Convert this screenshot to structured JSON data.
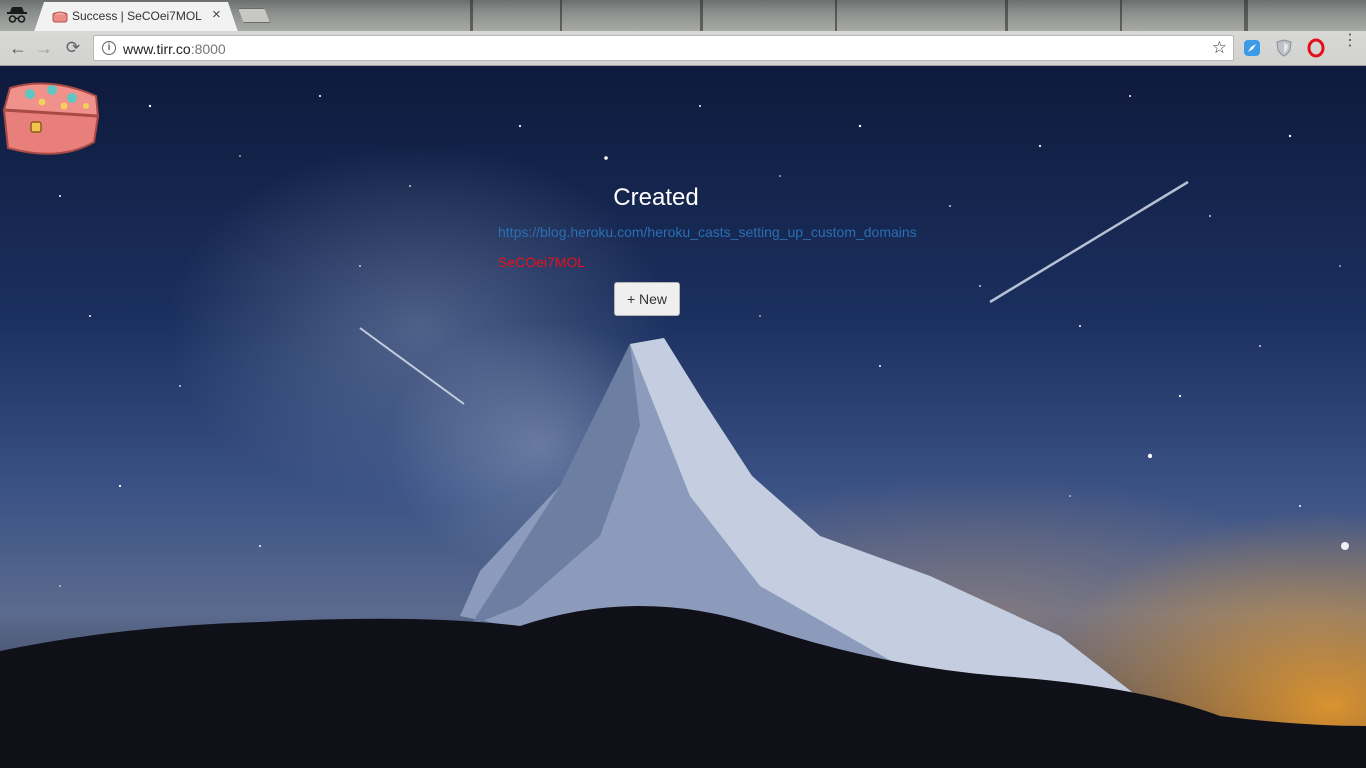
{
  "browser": {
    "tab": {
      "title": "Success | SeCOei7MOL",
      "close_glyph": "×"
    },
    "nav": {
      "back_glyph": "←",
      "forward_glyph": "→",
      "reload_glyph": "⟳"
    },
    "address_bar": {
      "host": "www.tirr.co",
      "port": ":8000",
      "info_glyph": "i"
    },
    "star_glyph": "☆",
    "menu_glyph": "⋮",
    "extensions": [
      "compass-extension-icon",
      "shield-extension-icon",
      "opera-extension-icon"
    ]
  },
  "page": {
    "heading": "Created",
    "link": "https://blog.heroku.com/heroku_casts_setting_up_custom_domains",
    "short_code": "SeCOei7MOL",
    "new_button_label": "+ New"
  },
  "colors": {
    "link": "#2a6fb2",
    "short_code": "#e8101a",
    "heading": "#ffffff"
  }
}
